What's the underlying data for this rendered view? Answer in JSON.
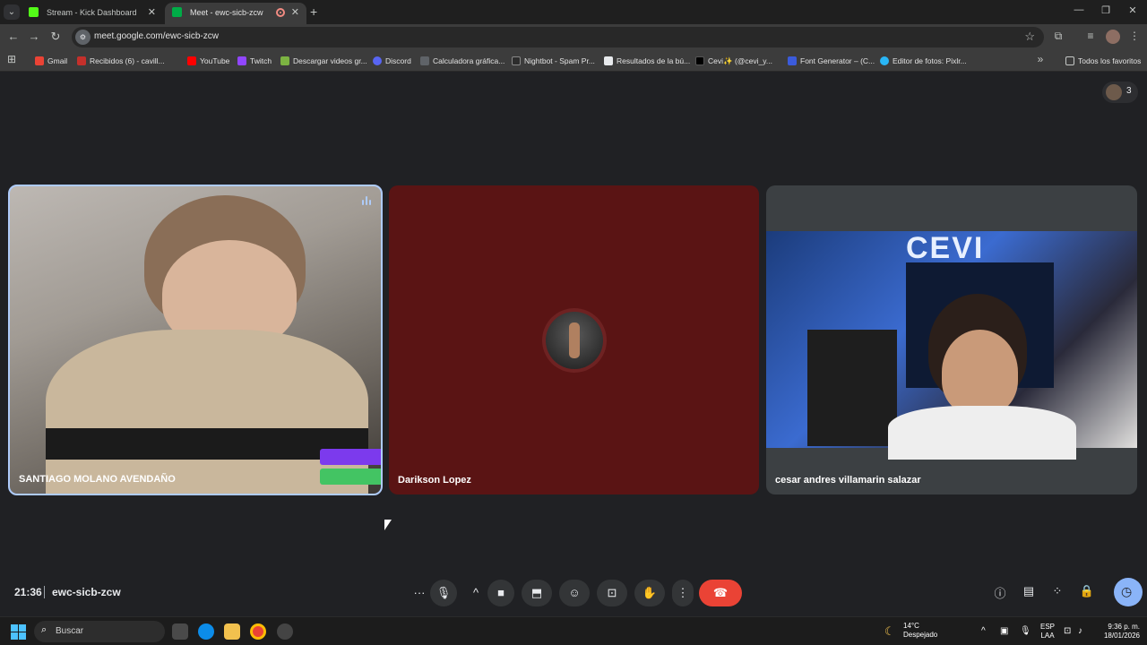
{
  "browser": {
    "tabs": [
      {
        "title": "Stream - Kick Dashboard",
        "favicon_color": "#53fc18"
      },
      {
        "title": "Meet - ewc-sicb-zcw",
        "favicon_color": "#00ac47"
      }
    ],
    "url": "meet.google.com/ewc-sicb-zcw",
    "bookmarks": [
      {
        "label": "Gmail",
        "color": "#ea4335"
      },
      {
        "label": "Recibidos (6) - cavill...",
        "color": "#c4302b"
      },
      {
        "label": "YouTube",
        "color": "#ff0000"
      },
      {
        "label": "Twitch",
        "color": "#9146ff"
      },
      {
        "label": "Descargar videos gr...",
        "color": "#7cb342"
      },
      {
        "label": "Discord",
        "color": "#5865f2"
      },
      {
        "label": "Calculadora gráfica...",
        "color": "#5f6368"
      },
      {
        "label": "Nightbot - Spam Pr...",
        "color": "#2d2d2d"
      },
      {
        "label": "Resultados de la bú...",
        "color": "#e8eaed"
      },
      {
        "label": "Cevi✨ (@cevi_y...",
        "color": "#000000"
      },
      {
        "label": "Font Generator – (C...",
        "color": "#3b5bdb"
      },
      {
        "label": "Editor de fotos: Pixlr...",
        "color": "#29b6f6"
      }
    ],
    "all_bookmarks_label": "Todos los favoritos"
  },
  "meet": {
    "participant_count": "3",
    "tiles": [
      {
        "name": "SANTIAGO MOLANO AVENDAÑO"
      },
      {
        "name": "Darikson Lopez"
      },
      {
        "name": "cesar andres villamarin salazar"
      }
    ],
    "tile3_banner": "CEVI",
    "time": "21:36",
    "meeting_code": "ewc-sicb-zcw",
    "accent_color": "#8ab4f8",
    "hangup_color": "#ea4335"
  },
  "taskbar": {
    "search_placeholder": "Buscar",
    "weather_temp": "14°C",
    "weather_desc": "Despejado",
    "lang_1": "ESP",
    "lang_2": "LAA",
    "clock_time": "9:36 p. m.",
    "clock_date": "18/01/2026"
  }
}
